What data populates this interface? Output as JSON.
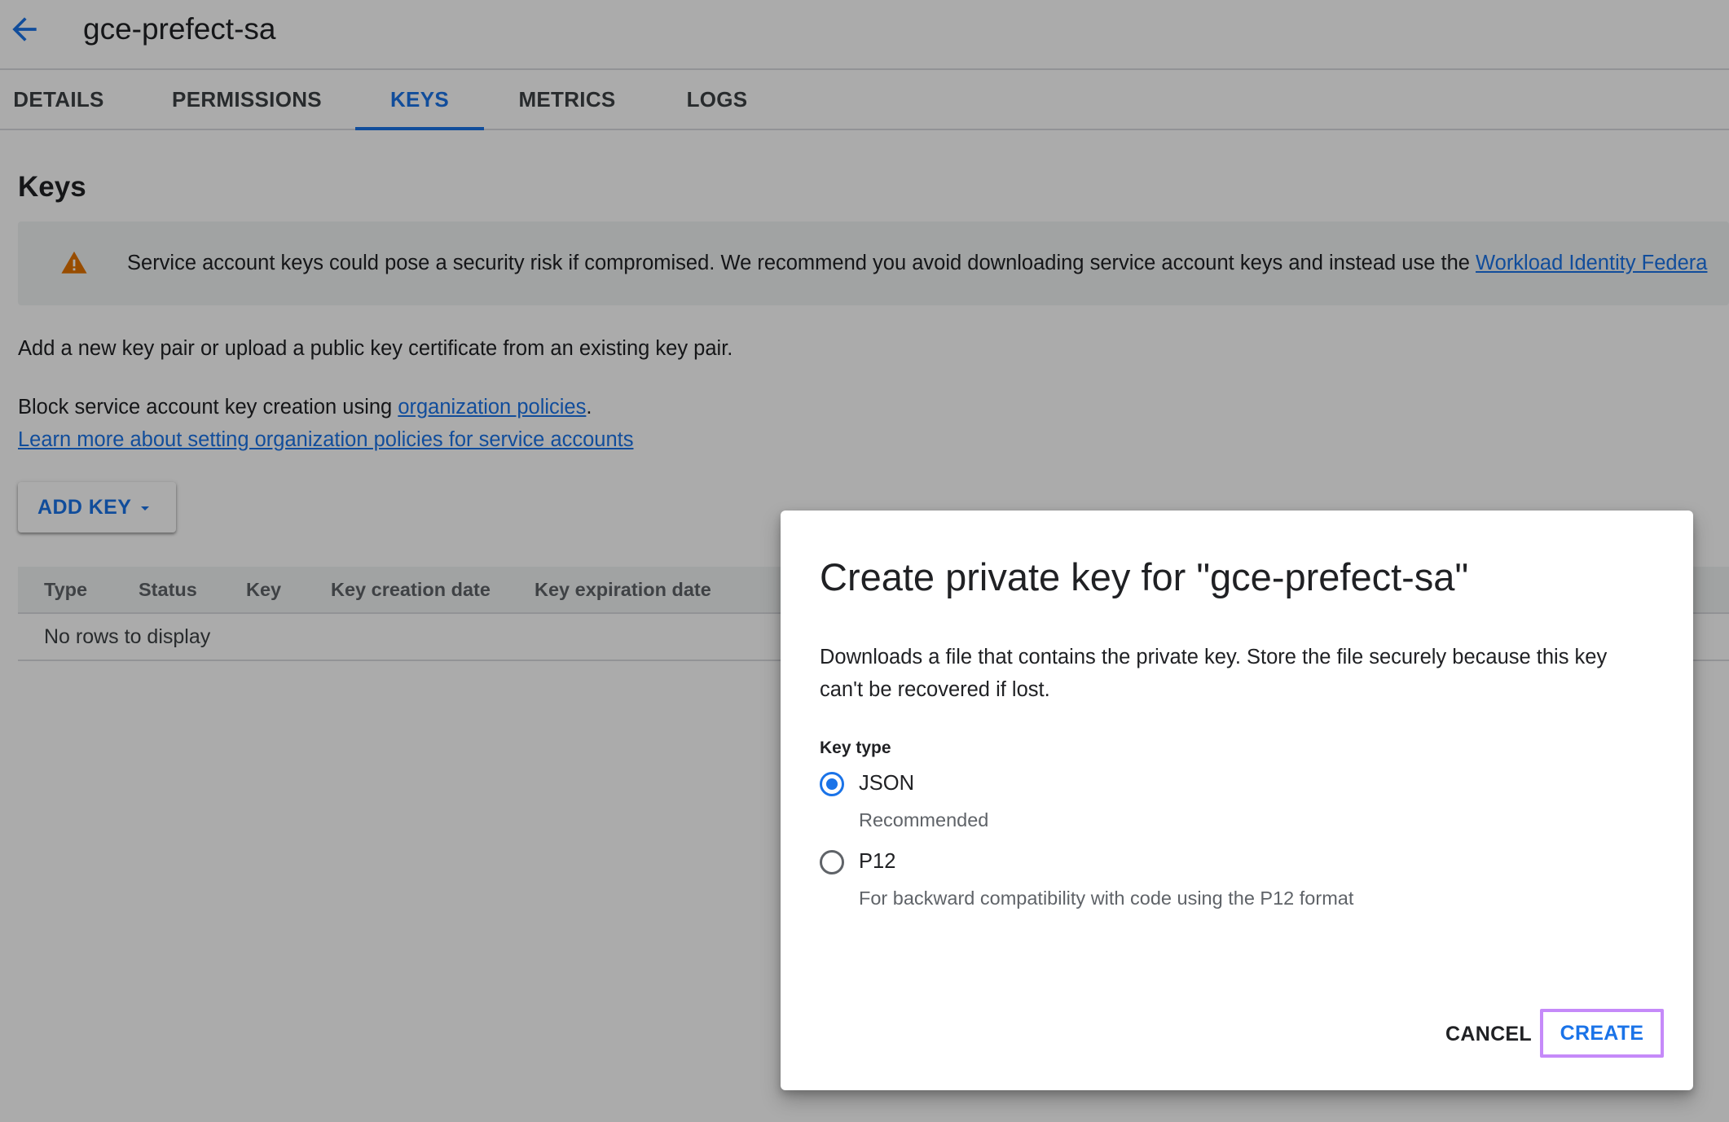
{
  "header": {
    "back_icon": "arrow-back-icon",
    "title": "gce-prefect-sa"
  },
  "tabs": [
    {
      "label": "DETAILS",
      "active": false
    },
    {
      "label": "PERMISSIONS",
      "active": false
    },
    {
      "label": "KEYS",
      "active": true
    },
    {
      "label": "METRICS",
      "active": false
    },
    {
      "label": "LOGS",
      "active": false
    }
  ],
  "content": {
    "section_title": "Keys",
    "warning": {
      "icon": "warning-triangle-icon",
      "text": "Service account keys could pose a security risk if compromised. We recommend you avoid downloading service account keys and instead use the ",
      "link": "Workload Identity Federa"
    },
    "add_pair_text": "Add a new key pair or upload a public key certificate from an existing key pair.",
    "block_text": "Block service account key creation using ",
    "block_link": "organization policies",
    "block_suffix": ".",
    "learn_more_link": "Learn more about setting organization policies for service accounts",
    "add_key_label": "ADD KEY",
    "add_key_icon": "caret-down-icon"
  },
  "table": {
    "columns": [
      "Type",
      "Status",
      "Key",
      "Key creation date",
      "Key expiration date"
    ],
    "empty_message": "No rows to display"
  },
  "dialog": {
    "title": "Create private key for \"gce-prefect-sa\"",
    "description": "Downloads a file that contains the private key. Store the file securely because this key can't be recovered if lost.",
    "key_type_label": "Key type",
    "options": [
      {
        "label": "JSON",
        "help": "Recommended",
        "selected": true
      },
      {
        "label": "P12",
        "help": "For backward compatibility with code using the P12 format",
        "selected": false
      }
    ],
    "cancel_label": "CANCEL",
    "create_label": "CREATE"
  },
  "colors": {
    "accent": "#1a73e8",
    "warning": "#e37400",
    "focus_outline": "#c58af9"
  }
}
